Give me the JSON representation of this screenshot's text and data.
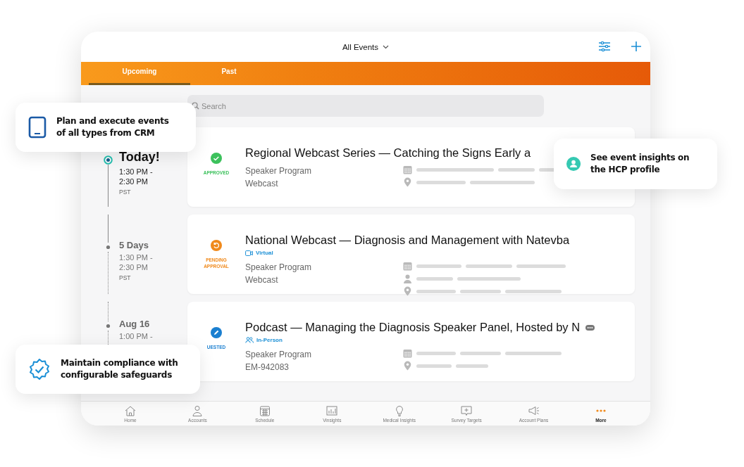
{
  "header": {
    "title": "All Events"
  },
  "tabs": [
    {
      "label": "Upcoming",
      "selected": true
    },
    {
      "label": "Past",
      "selected": false
    }
  ],
  "search": {
    "placeholder": "Search"
  },
  "timeline": [
    {
      "label": "Today!",
      "current": true,
      "times": [
        "1:30 PM -",
        "2:30 PM"
      ],
      "zone": "PST"
    },
    {
      "label": "5 Days",
      "current": false,
      "times": [
        "1:30 PM -",
        "2:30 PM"
      ],
      "zone": "PST"
    },
    {
      "label": "Aug 16",
      "current": false,
      "times": [
        "1:00 PM -"
      ]
    }
  ],
  "events": [
    {
      "title": "Regional Webcast Series — Catching the Signs Early a",
      "status": {
        "kind": "approved",
        "label": "APPROVED"
      },
      "lines": [
        "Speaker Program",
        "Webcast"
      ],
      "meta": [
        {
          "kind": "calendar"
        },
        {
          "kind": "location"
        }
      ]
    },
    {
      "title": "National Webcast — Diagnosis and Management with Natevba",
      "status": {
        "kind": "pending",
        "label": "PENDING APPROVAL"
      },
      "mode": {
        "kind": "virtual",
        "label": "Virtual"
      },
      "lines": [
        "Speaker Program",
        "Webcast"
      ],
      "meta": [
        {
          "kind": "calendar"
        },
        {
          "kind": "person"
        },
        {
          "kind": "location"
        }
      ]
    },
    {
      "title": "Podcast — Managing the Diagnosis Speaker Panel, Hosted by N",
      "status": {
        "kind": "requested",
        "label": "UESTED"
      },
      "mode": {
        "kind": "in-person",
        "label": "In-Person"
      },
      "lines": [
        "Speaker Program",
        "EM-942083"
      ],
      "meta": [
        {
          "kind": "calendar"
        },
        {
          "kind": "location"
        }
      ],
      "more": true
    }
  ],
  "nav": [
    {
      "label": "Home",
      "kind": "home",
      "selected": false
    },
    {
      "label": "Accounts",
      "kind": "accounts",
      "selected": false
    },
    {
      "label": "Schedule",
      "kind": "schedule",
      "selected": false
    },
    {
      "label": "Vinsights",
      "kind": "chart",
      "selected": false
    },
    {
      "label": "Medical Insights",
      "kind": "bulb",
      "selected": false
    },
    {
      "label": "Survey Targets",
      "kind": "survey",
      "selected": false
    },
    {
      "label": "Account Plans",
      "kind": "megaphone",
      "selected": false
    },
    {
      "label": "More",
      "kind": "more",
      "selected": true
    }
  ],
  "callouts": [
    {
      "kind": "tablet",
      "text": "Plan and execute events of all types from CRM"
    },
    {
      "kind": "person",
      "text": "See event insights on the HCP profile"
    },
    {
      "kind": "badge",
      "text": "Maintain compliance with configurable safeguards"
    }
  ]
}
